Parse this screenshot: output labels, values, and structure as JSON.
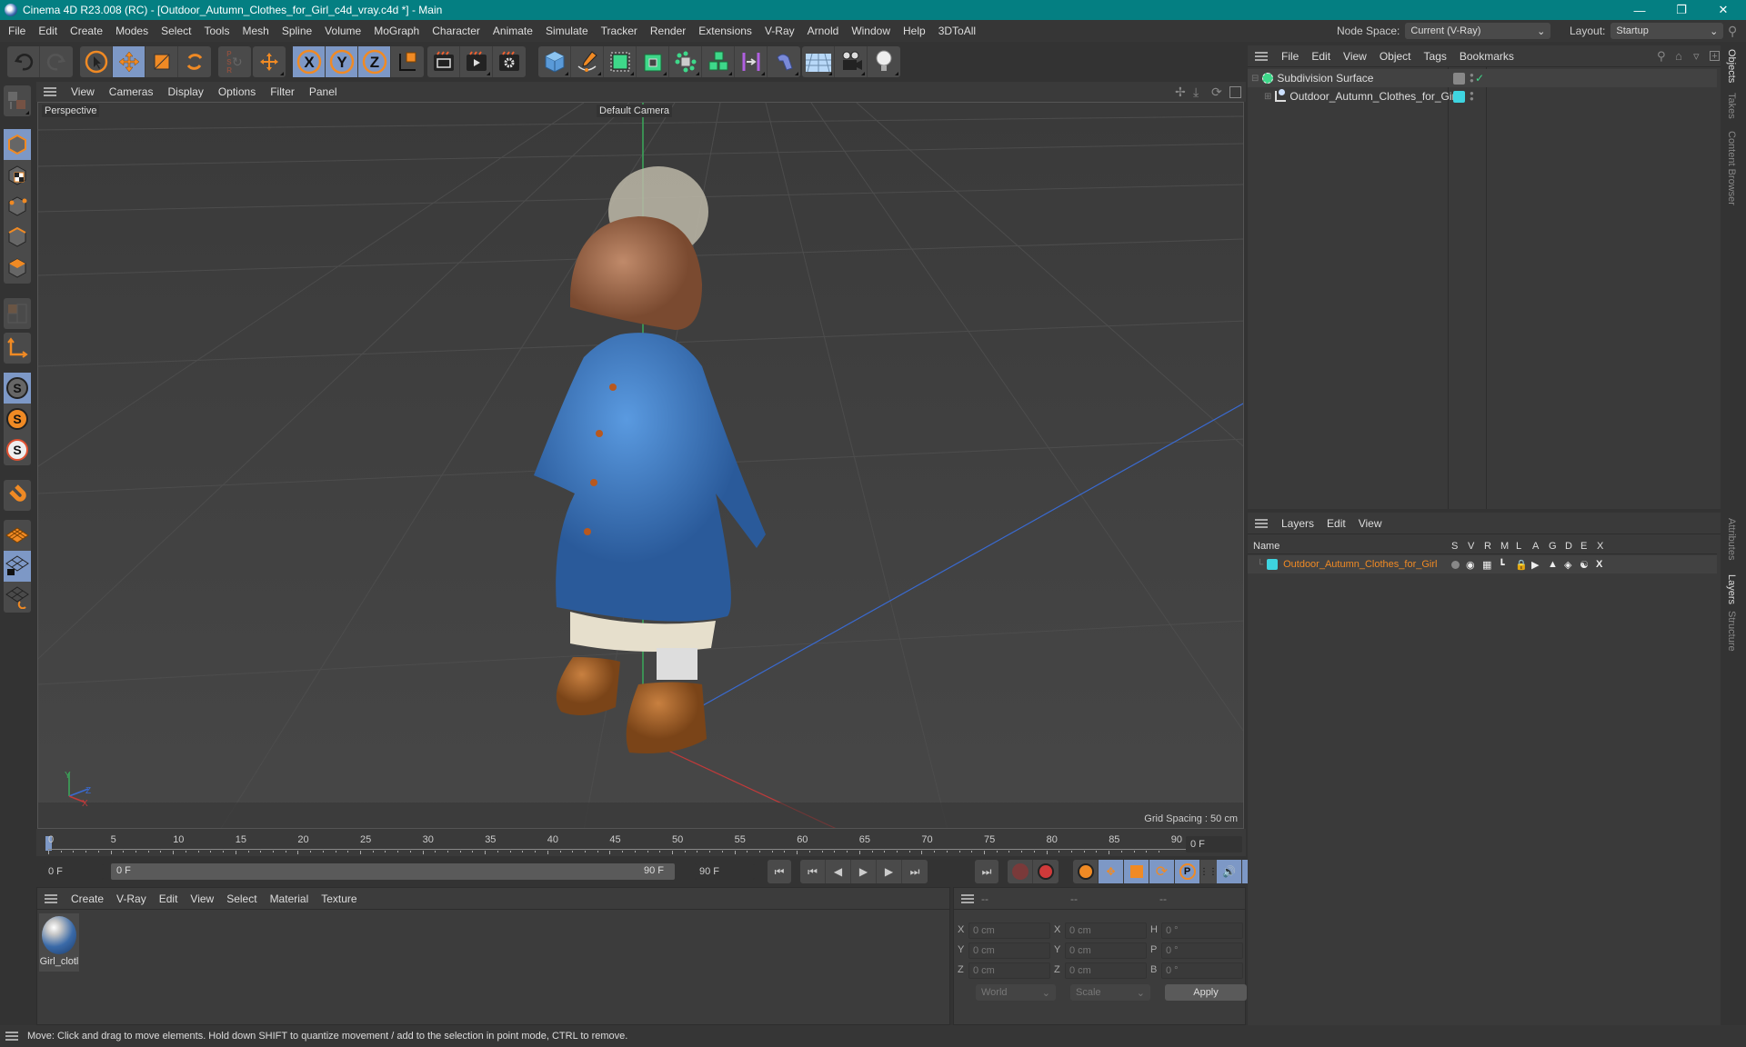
{
  "window": {
    "title": "Cinema 4D R23.008 (RC) - [Outdoor_Autumn_Clothes_for_Girl_c4d_vray.c4d *] - Main",
    "controls": [
      "minimize",
      "restore",
      "close"
    ]
  },
  "menubar": {
    "items": [
      "File",
      "Edit",
      "Create",
      "Modes",
      "Select",
      "Tools",
      "Mesh",
      "Spline",
      "Volume",
      "MoGraph",
      "Character",
      "Animate",
      "Simulate",
      "Tracker",
      "Render",
      "Extensions",
      "V-Ray",
      "Arnold",
      "Window",
      "Help",
      "3DToAll"
    ],
    "node_space_label": "Node Space:",
    "node_space_value": "Current (V-Ray)",
    "layout_label": "Layout:",
    "layout_value": "Startup"
  },
  "toolbar": {
    "groups": [
      [
        "undo-icon",
        "redo-icon"
      ],
      [
        "select-icon",
        "move-icon",
        "scale-icon",
        "rotate-icon"
      ],
      [
        "psr-icon"
      ],
      [
        "transform-icon"
      ],
      [
        "x-axis-icon",
        "y-axis-icon",
        "z-axis-icon",
        "coordinate-system-icon"
      ],
      [
        "render-view-icon",
        "render-picture-viewer-icon",
        "render-settings-icon"
      ],
      [
        "cube-icon",
        "pen-icon",
        "subdivision-icon",
        "extrude-icon",
        "array-icon",
        "cloner-icon",
        "symmetry-icon",
        "deformer-icon"
      ],
      [
        "floor-icon",
        "camera-icon",
        "light-icon"
      ]
    ]
  },
  "viewport": {
    "menu": [
      "View",
      "Cameras",
      "Display",
      "Options",
      "Filter",
      "Panel"
    ],
    "view_name": "Perspective",
    "camera_label": "Default Camera",
    "grid_spacing": "Grid Spacing : 50 cm",
    "axis_labels": {
      "x": "X",
      "y": "Y",
      "z": "Z"
    }
  },
  "timeline": {
    "ticks": [
      "0",
      "5",
      "10",
      "15",
      "20",
      "25",
      "30",
      "35",
      "40",
      "45",
      "50",
      "55",
      "60",
      "65",
      "70",
      "75",
      "80",
      "85",
      "90"
    ],
    "current_frame_right": "0 F",
    "start_field": "0 F",
    "range_start": "0 F",
    "range_end": "90 F",
    "end_field": "90 F"
  },
  "material_manager": {
    "menu": [
      "Create",
      "V-Ray",
      "Edit",
      "View",
      "Select",
      "Material",
      "Texture"
    ],
    "materials": [
      {
        "name": "Girl_clotl"
      }
    ]
  },
  "coordinates": {
    "headers": [
      "--",
      "--",
      "--"
    ],
    "rows": [
      {
        "l1": "X",
        "v1": "0 cm",
        "l2": "X",
        "v2": "0 cm",
        "l3": "H",
        "v3": "0 °"
      },
      {
        "l1": "Y",
        "v1": "0 cm",
        "l2": "Y",
        "v2": "0 cm",
        "l3": "P",
        "v3": "0 °"
      },
      {
        "l1": "Z",
        "v1": "0 cm",
        "l2": "Z",
        "v2": "0 cm",
        "l3": "B",
        "v3": "0 °"
      }
    ],
    "space": "World",
    "mode": "Scale",
    "apply": "Apply"
  },
  "object_manager": {
    "menu": [
      "File",
      "Edit",
      "View",
      "Object",
      "Tags",
      "Bookmarks"
    ],
    "objects": [
      {
        "name": "Subdivision Surface",
        "level": 0
      },
      {
        "name": "Outdoor_Autumn_Clothes_for_Girl",
        "level": 1
      }
    ]
  },
  "layer_manager": {
    "menu": [
      "Layers",
      "Edit",
      "View"
    ],
    "columns": [
      "Name",
      "S",
      "V",
      "R",
      "M",
      "L",
      "A",
      "G",
      "D",
      "E",
      "X"
    ],
    "layers": [
      {
        "name": "Outdoor_Autumn_Clothes_for_Girl",
        "color": "#3ed4e0"
      }
    ]
  },
  "side_tabs": {
    "top": [
      "Objects",
      "Takes",
      "Content Browser"
    ],
    "bottom": [
      "Attributes",
      "Layers",
      "Structure"
    ]
  },
  "status": "Move: Click and drag to move elements. Hold down SHIFT to quantize movement / add to the selection in point mode, CTRL to remove.",
  "colors": {
    "titlebar": "#047f82",
    "accent_orange": "#f08a24",
    "selected_blue": "#7d98c6",
    "layer_name": "#f08a24"
  }
}
